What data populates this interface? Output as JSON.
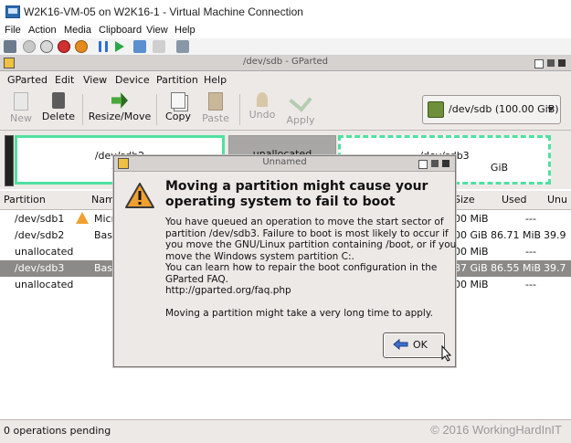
{
  "host": {
    "title": "W2K16-VM-05 on W2K16-1 - Virtual Machine Connection",
    "menu": [
      "File",
      "Action",
      "Media",
      "Clipboard",
      "View",
      "Help"
    ]
  },
  "gparted": {
    "title": "/dev/sdb - GParted",
    "menu": [
      "GParted",
      "Edit",
      "View",
      "Device",
      "Partition",
      "Help"
    ],
    "toolbar": {
      "new": "New",
      "delete": "Delete",
      "resize_move": "Resize/Move",
      "copy": "Copy",
      "paste": "Paste",
      "undo": "Undo",
      "apply": "Apply"
    },
    "device_select": "/dev/sdb  (100.00 GiB)",
    "disk_map": {
      "sdb2_name": "/dev/sdb2",
      "sdb2_size": "40.",
      "unalloc_label": "unallocated",
      "sdb3_name": "/dev/sdb3",
      "sdb3_size": "GiB"
    },
    "table": {
      "headers": [
        "Partition",
        "Nam",
        "Size",
        "Used",
        "Unu"
      ],
      "rows": [
        {
          "partition": "/dev/sdb1",
          "name": "Micr",
          "size": "00 MiB",
          "used": "---",
          "unused": ""
        },
        {
          "partition": "/dev/sdb2",
          "name": "Basi",
          "size": "00 GiB",
          "used": "86.71 MiB",
          "unused": "39.9"
        },
        {
          "partition": "unallocated",
          "name": "",
          "size": "00 MiB",
          "used": "---",
          "unused": ""
        },
        {
          "partition": "/dev/sdb3",
          "name": "Basi",
          "size": "87 GiB",
          "used": "86.55 MiB",
          "unused": "39.7"
        },
        {
          "partition": "unallocated",
          "name": "",
          "size": "00 MiB",
          "used": "---",
          "unused": ""
        }
      ]
    },
    "status": "0 operations pending",
    "watermark": "© 2016 WorkingHardInIT"
  },
  "dialog": {
    "title": "Unnamed",
    "heading_lines": [
      "Moving a partition might cause your",
      "operating system to fail to boot"
    ],
    "body_lines": [
      "You have queued an operation to move the start sector of",
      "partition /dev/sdb3.  Failure to boot is most likely to occur if",
      "you move the GNU/Linux partition containing /boot, or if you",
      "move the Windows system partition C:.",
      "You can learn how to repair the boot configuration in the",
      "GParted FAQ.",
      "http://gparted.org/faq.php",
      "",
      "Moving a partition might take a very long time to apply."
    ],
    "ok_label": "OK"
  },
  "colors": {
    "partition_green": "#50e0a0",
    "unallocated_gray": "#a9a7a5",
    "selected_row": "#8c8a88",
    "warning_orange": "#f0a030"
  },
  "icons": [
    "app-icon",
    "ctrl-alt-del-icon",
    "start-icon",
    "turnoff-icon",
    "shutdown-icon",
    "save-icon",
    "pause-icon",
    "reset-icon",
    "checkpoint-icon",
    "revert-icon",
    "enhanced-session-icon",
    "new-icon",
    "delete-icon",
    "resize-move-icon",
    "copy-icon",
    "paste-icon",
    "undo-icon",
    "apply-icon",
    "harddisk-icon",
    "dropdown-icon",
    "warning-icon",
    "ok-arrow-icon"
  ]
}
